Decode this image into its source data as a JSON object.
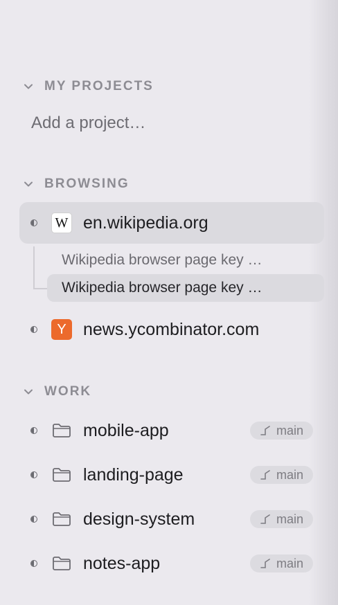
{
  "sections": {
    "my_projects": {
      "title": "MY PROJECTS",
      "placeholder": "Add a project…"
    },
    "browsing": {
      "title": "BROWSING",
      "items": [
        {
          "label": "en.wikipedia.org",
          "favicon": "W",
          "icon": "wikipedia-icon",
          "children": [
            "Wikipedia browser page key …",
            "Wikipedia browser page key …"
          ]
        },
        {
          "label": "news.ycombinator.com",
          "favicon": "Y",
          "icon": "ycombinator-icon",
          "color": "#ec6a2c"
        }
      ]
    },
    "work": {
      "title": "WORK",
      "items": [
        {
          "label": "mobile-app",
          "branch": "main"
        },
        {
          "label": "landing-page",
          "branch": "main"
        },
        {
          "label": "design-system",
          "branch": "main"
        },
        {
          "label": "notes-app",
          "branch": "main"
        }
      ]
    }
  },
  "colors": {
    "background": "#ebe9ee",
    "selected": "#dbdadf",
    "yc_orange": "#ec6a2c"
  }
}
